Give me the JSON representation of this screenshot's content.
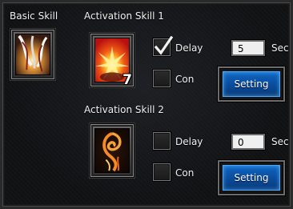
{
  "basic_skill": {
    "title": "Basic Skill"
  },
  "activation_1": {
    "title": "Activation Skill 1",
    "badge": "7",
    "delay_label": "Delay",
    "delay_checked": true,
    "con_label": "Con",
    "con_checked": false,
    "delay_value": "5",
    "unit": "Sec",
    "setting_label": "Setting"
  },
  "activation_2": {
    "title": "Activation Skill 2",
    "delay_label": "Delay",
    "delay_checked": false,
    "con_label": "Con",
    "con_checked": false,
    "delay_value": "0",
    "unit": "Sec",
    "setting_label": "Setting"
  },
  "colors": {
    "button_blue": "#0a4c9a",
    "button_glow": "#49a8ff",
    "input_bg": "#efefef"
  }
}
